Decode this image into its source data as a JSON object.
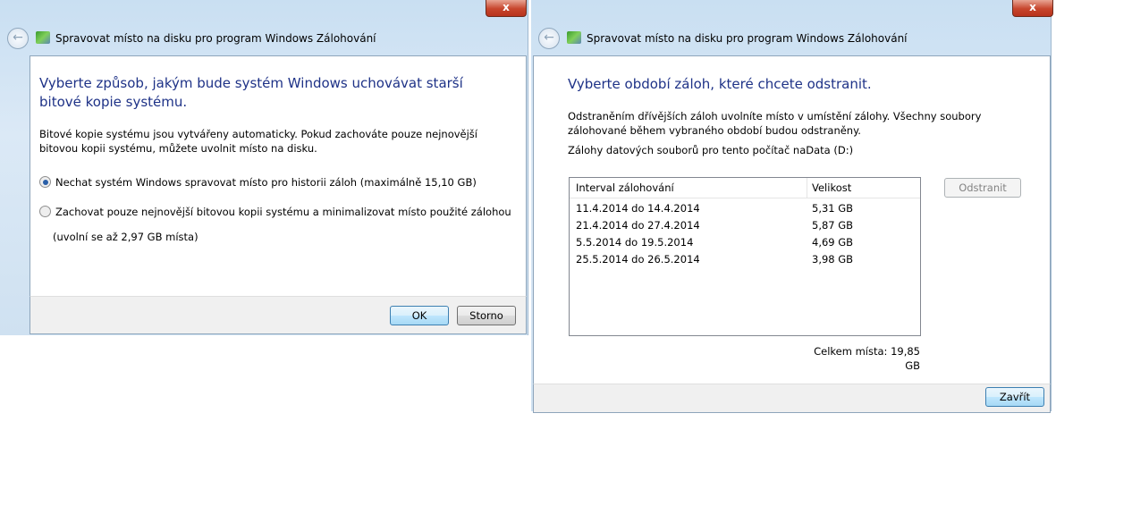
{
  "left_dialog": {
    "title": "Spravovat místo na disku pro program Windows Zálohování",
    "close": "x",
    "heading": "Vyberte způsob, jakým bude systém Windows uchovávat starší bitové kopie systému.",
    "description": "Bitové kopie systému jsou vytvářeny automaticky. Pokud zachováte pouze nejnovější bitovou kopii systému, můžete uvolnit místo na disku.",
    "options": [
      {
        "label": "Nechat systém Windows spravovat místo pro historii záloh (maximálně 15,10 GB)",
        "selected": true
      },
      {
        "label": "Zachovat pouze nejnovější bitovou kopii systému a minimalizovat místo použité zálohou",
        "selected": false
      }
    ],
    "option_note": "(uvolní se až 2,97 GB místa)",
    "ok": "OK",
    "cancel": "Storno"
  },
  "right_dialog": {
    "title": "Spravovat místo na disku pro program Windows Zálohování",
    "close": "x",
    "heading": "Vyberte období záloh, které chcete odstranit.",
    "description": "Odstraněním dřívějších záloh uvolníte místo v umístění zálohy. Všechny soubory zálohované během vybraného období budou odstraněny.",
    "subheading": "Zálohy datových souborů pro tento počítač naData (D:)",
    "columns": [
      "Interval zálohování",
      "Velikost"
    ],
    "rows": [
      [
        "11.4.2014 do 14.4.2014",
        "5,31 GB"
      ],
      [
        "21.4.2014 do 27.4.2014",
        "5,87 GB"
      ],
      [
        "5.5.2014 do 19.5.2014",
        "4,69 GB"
      ],
      [
        "25.5.2014 do 26.5.2014",
        "3,98 GB"
      ]
    ],
    "delete": "Odstranit",
    "total": "Celkem místa: 19,85 GB",
    "close_button": "Zavřít"
  }
}
